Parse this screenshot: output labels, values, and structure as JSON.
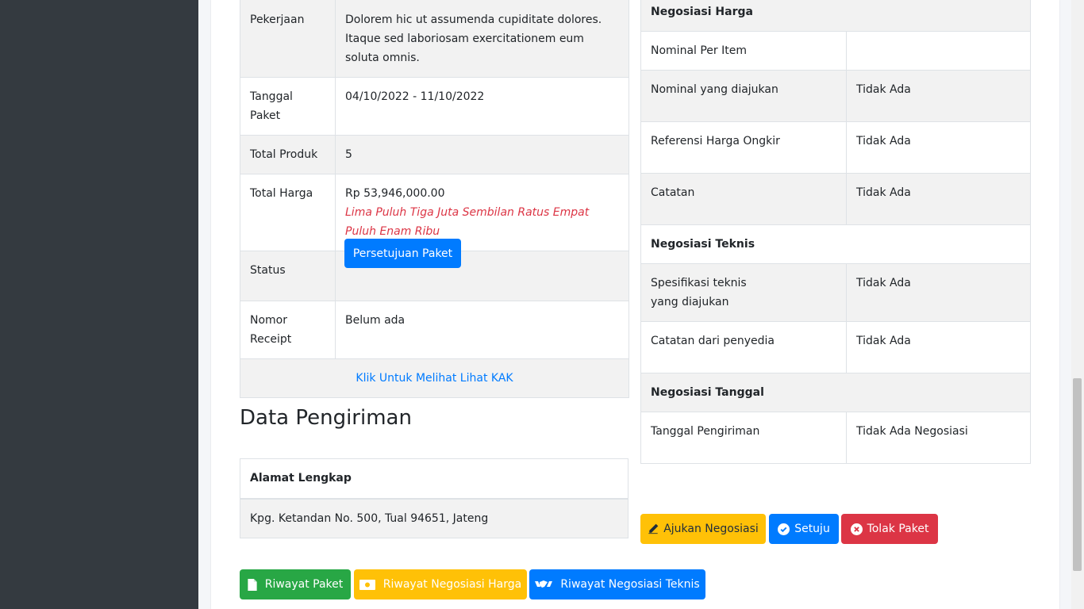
{
  "package": {
    "rows": [
      {
        "label": "Pekerjaan",
        "value": "Dolorem hic ut assumenda cupiditate dolores. Itaque sed laboriosam exercitationem eum soluta omnis."
      },
      {
        "label": "Tanggal Paket",
        "value": "04/10/2022 - 11/10/2022"
      },
      {
        "label": "Total Produk",
        "value": "5"
      },
      {
        "label": "Total Harga",
        "value": "Rp 53,946,000.00",
        "words": "Lima Puluh Tiga Juta Sembilan Ratus Empat Puluh Enam Ribu"
      },
      {
        "label": "Status",
        "button": "Persetujuan Paket"
      },
      {
        "label": "Nomor Receipt",
        "value": "Belum ada"
      }
    ],
    "kak_link": "Klik Untuk Melihat Lihat KAK"
  },
  "shipping": {
    "title": "Data Pengiriman",
    "address_header": "Alamat Lengkap",
    "address": "Kpg. Ketandan No. 500, Tual 94651, Jateng"
  },
  "negotiation": {
    "price_header": "Negosiasi Harga",
    "price_rows": [
      {
        "label": "Nominal Per Item",
        "value": ""
      },
      {
        "label": "Nominal yang diajukan",
        "value": "Tidak Ada"
      },
      {
        "label": "Referensi Harga Ongkir",
        "value": "Tidak Ada"
      },
      {
        "label": "Catatan",
        "value": "Tidak Ada"
      }
    ],
    "tech_header": "Negosiasi Teknis",
    "tech_rows": [
      {
        "label": "Spesifikasi teknis yang diajukan",
        "value": "Tidak Ada"
      },
      {
        "label": "Catatan dari penyedia",
        "value": "Tidak Ada"
      }
    ],
    "date_header": "Negosiasi Tanggal",
    "date_rows": [
      {
        "label": "Tanggal Pengiriman",
        "value": "Tidak Ada Negosiasi"
      }
    ]
  },
  "actions": {
    "ajukan": "Ajukan Negosiasi",
    "setuju": "Setuju",
    "tolak": "Tolak Paket"
  },
  "history": {
    "paket": "Riwayat Paket",
    "harga": "Riwayat Negosiasi Harga",
    "teknis": "Riwayat Negosiasi Teknis"
  },
  "colors": {
    "primary": "#007bff",
    "warning": "#ffc107",
    "danger": "#dc3545",
    "success": "#28a745",
    "sidebar": "#343a40"
  }
}
